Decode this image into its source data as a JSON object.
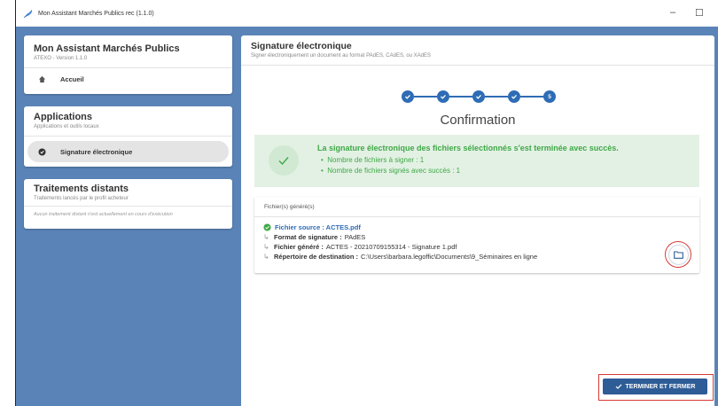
{
  "window": {
    "title": "Mon Assistant Marchés Publics rec (1.1.0)",
    "minimize_label": "–",
    "maximize_label": "☐"
  },
  "sidebar": {
    "app": {
      "title": "Mon Assistant Marchés Publics",
      "version": "ATEXO - Version 1.1.0",
      "home_label": "Accueil"
    },
    "applications": {
      "title": "Applications",
      "subtitle": "Applications et outils locaux",
      "items": [
        {
          "label": "Signature électronique",
          "selected": true
        }
      ]
    },
    "remote": {
      "title": "Traitements distants",
      "subtitle": "Traitements lancés par le profil acheteur",
      "empty_message": "Aucun traitement distant n'est actuellement en cours d'exécution"
    }
  },
  "main": {
    "title": "Signature électronique",
    "subtitle": "Signer électroniquement un document au format PAdES, CAdES, ou XAdES",
    "stepper": {
      "current_step": "5",
      "total_steps": 5,
      "completed_steps": 4
    },
    "step_title": "Confirmation",
    "success": {
      "message": "La signature électronique des fichiers sélectionnés s'est terminée avec succès.",
      "items": [
        "Nombre de fichiers à signer : 1",
        "Nombre de fichiers signés avec succès : 1"
      ]
    },
    "files": {
      "header": "Fichier(s) généré(s)",
      "source_label": "Fichier source : ACTES.pdf",
      "format_label": "Format de signature :",
      "format_value": "PAdES",
      "generated_label": "Fichier généré :",
      "generated_value": "ACTES - 20210709155314 - Signature 1.pdf",
      "destination_label": "Répertoire de destination :",
      "destination_value": "C:\\Users\\barbara.legoffic\\Documents\\9_Séminaires en ligne"
    },
    "finish_button": "TERMINER ET FERMER"
  },
  "colors": {
    "background": "#5a84b8",
    "primary": "#2e6cb5",
    "success": "#3fa847",
    "success_bg": "#e3f1e4",
    "highlight": "#d73a35"
  }
}
